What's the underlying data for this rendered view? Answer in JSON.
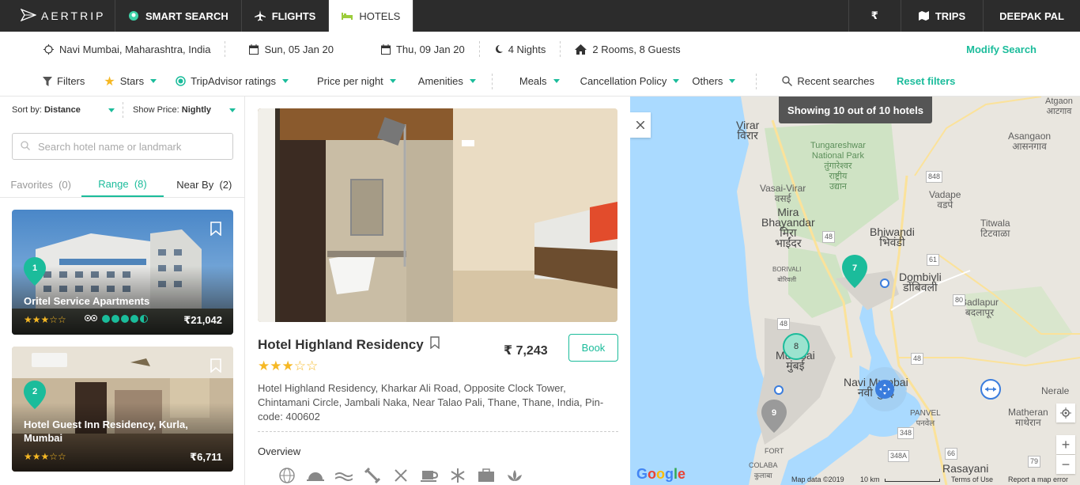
{
  "brand": {
    "name": "AERTRIP"
  },
  "nav": {
    "smart_search": "SMART SEARCH",
    "flights": "FLIGHTS",
    "hotels": "HOTELS",
    "currency": "₹",
    "trips": "TRIPS",
    "user": "DEEPAK PAL"
  },
  "search": {
    "location": "Navi Mumbai, Maharashtra, India",
    "checkin": "Sun, 05 Jan 20",
    "checkout": "Thu, 09 Jan 20",
    "nights": "4 Nights",
    "rooms_guests": "2 Rooms, 8 Guests",
    "modify": "Modify Search"
  },
  "filters": {
    "filters": "Filters",
    "stars": "Stars",
    "tripadvisor": "TripAdvisor ratings",
    "price": "Price per night",
    "amenities": "Amenities",
    "meals": "Meals",
    "cancellation": "Cancellation Policy",
    "others": "Others",
    "recent": "Recent searches",
    "reset": "Reset filters"
  },
  "left": {
    "sort_label": "Sort by:",
    "sort_value": "Distance",
    "price_label": "Show Price:",
    "price_value": "Nightly",
    "search_placeholder": "Search hotel name or landmark",
    "tabs": [
      {
        "label": "Favorites",
        "count": "(0)"
      },
      {
        "label": "Range",
        "count": "(8)"
      },
      {
        "label": "Near By",
        "count": "(2)"
      }
    ],
    "cards": [
      {
        "pin": "1",
        "name": "Oritel Service Apartments",
        "stars": "★★★☆☆",
        "price": "₹21,042",
        "ta_rating": 4.5
      },
      {
        "pin": "2",
        "name": "Hotel Guest Inn Residency, Kurla, Mumbai",
        "stars": "★★★☆☆",
        "price": "₹6,711"
      }
    ]
  },
  "detail": {
    "name": "Hotel Highland Residency",
    "price": "₹ 7,243",
    "book": "Book",
    "stars": "★★★☆☆",
    "address": "Hotel Highland Residency, Kharkar Ali Road, Opposite Clock Tower, Chintamani Circle, Jambali Naka, Near Talao Pali, Thane, Thane, India, Pin-code: 400602",
    "overview": "Overview",
    "amenity_icons": [
      "globe-icon",
      "room-service-icon",
      "pool-icon",
      "gym-icon",
      "restaurant-icon",
      "coffee-icon",
      "ac-icon",
      "business-icon",
      "spa-icon"
    ]
  },
  "map": {
    "showing": "Showing 10 out of 10 hotels",
    "labels": {
      "virar": "Virar\nविरार",
      "tungareshwar": "Tungareshwar\nNational Park\nतुंगारेश्वर\nराष्ट्रीय\nउद्यान",
      "vasai": "Vasai-Virar\nवसई",
      "mira": "Mira\nBhayandar\nमिरा\nभाईंदर",
      "bhiwandi": "Bhiwandi\nभिवंडी",
      "dombivli": "Dombivli\nडोंबिवली",
      "badlapur": "Badlapur\nबदलापूर",
      "titwala": "Titwala\nटिटवाळा",
      "vadape": "Vadape\nवडपे",
      "asangaon": "Asangaon\nआसनगाव",
      "atgaon": "Atgaon\nआटगाव",
      "mumbai": "Mumbai\nमुंबई",
      "navi_mumbai": "Navi Mumbai\nनवी मुंबई",
      "panvel": "PANVEL\nपनवेल",
      "matheran": "Matheran\nमाथेरान",
      "nerale": "Nerale",
      "rasayani": "Rasayani",
      "borivali": "BORIVALI\nबोरिवली",
      "colaba": "COLABA\nकुलाबा",
      "fort": "FORT"
    },
    "road_numbers": [
      "848",
      "48",
      "48",
      "61",
      "80",
      "48",
      "348",
      "348A",
      "66",
      "79"
    ],
    "pins": [
      "7",
      "8",
      "9"
    ],
    "footer_data": "Map data ©2019",
    "scale": "10 km",
    "terms": "Terms of Use",
    "report": "Report a map error",
    "google": "Google"
  },
  "colors": {
    "accent": "#1bbc9b",
    "star": "#f6b824",
    "topbar": "#2c2c2c"
  }
}
